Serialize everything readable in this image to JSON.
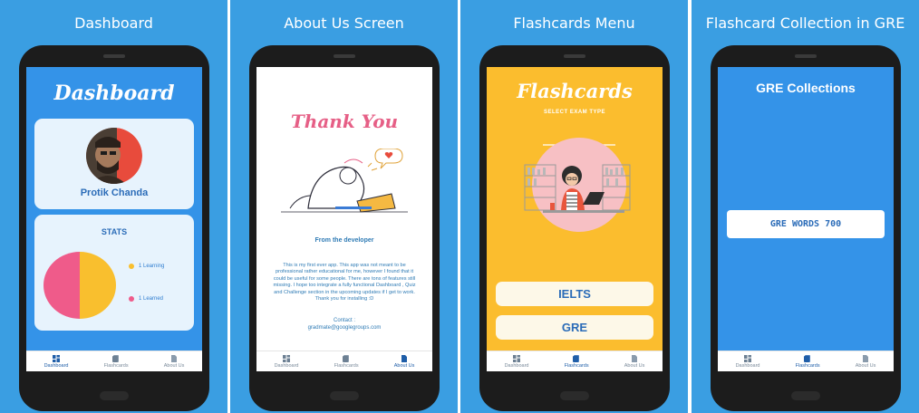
{
  "panels": [
    {
      "title": "Dashboard"
    },
    {
      "title": "About Us Screen"
    },
    {
      "title": "Flashcards Menu"
    },
    {
      "title": "Flashcard Collection in GRE"
    }
  ],
  "nav": {
    "dashboard": "Dashboard",
    "flashcards": "Flashcards",
    "about": "About Us"
  },
  "dashboard": {
    "header": "Dashboard",
    "user_name": "Protik Chanda",
    "stats_title": "STATS",
    "legend": [
      {
        "label": "1 Learning",
        "color": "#f9bf2e",
        "value": 1
      },
      {
        "label": "1 Learned",
        "color": "#ef5b8a",
        "value": 1
      }
    ]
  },
  "about": {
    "thank_you": "Thank You",
    "from_dev": "From the developer",
    "paragraph": "This is my first ever app. This app was not meant to be professional rather educational for me, however I found that it could be useful for some people. There are tons of features still missing. I hope too integrate a fully functional Dashboard , Quiz and Challenge section in the upcoming updates if I get to work. Thank you for installing :D",
    "contact_label": "Contact :",
    "contact_email": "gradmate@googlegroups.com"
  },
  "flashcards": {
    "header": "Flashcards",
    "subtitle": "SELECT EXAM TYPE",
    "buttons": [
      "IELTS",
      "GRE"
    ]
  },
  "gre": {
    "header": "GRE Collections",
    "items": [
      "GRE WORDS 700"
    ]
  },
  "colors": {
    "panel_bg": "#3a9ee2",
    "dashboard_bg": "#3493e8",
    "flashcards_bg": "#fbbd2e",
    "pie_learning": "#f9bf2e",
    "pie_learned": "#ef5b8a"
  }
}
